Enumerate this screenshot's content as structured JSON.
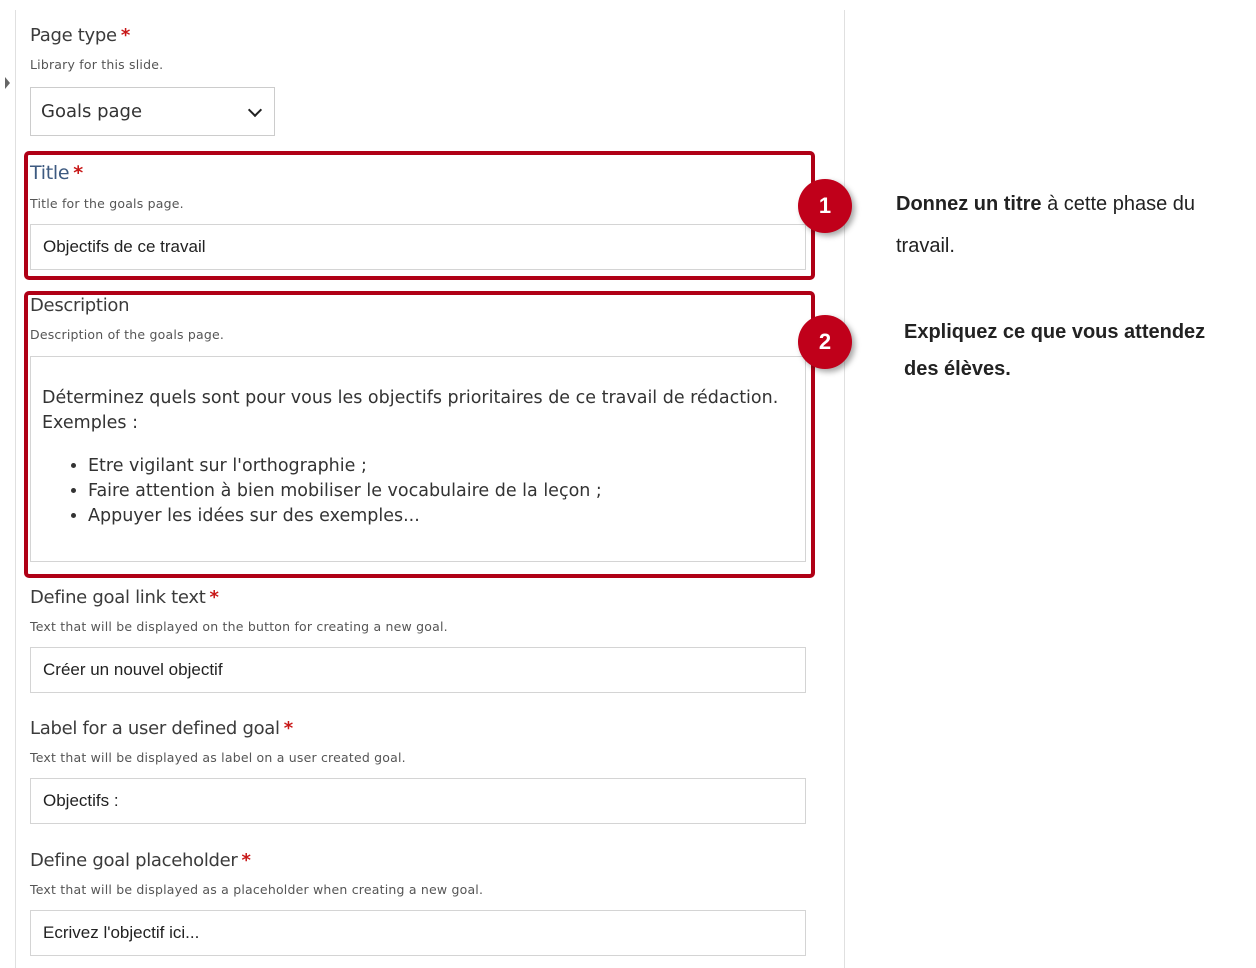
{
  "form": {
    "page_type": {
      "label": "Page type",
      "required": "*",
      "description": "Library for this slide.",
      "selected": "Goals page"
    },
    "title": {
      "label": "Title",
      "required": "*",
      "description": "Title for the goals page.",
      "value": "Objectifs de ce travail"
    },
    "description": {
      "label": "Description",
      "description": "Description of the goals page.",
      "paragraph": "Déterminez quels sont pour vous les objectifs prioritaires de ce travail de rédaction.",
      "paragraph2": "Exemples :",
      "bullets": [
        "Etre vigilant sur l'orthographie ;",
        "Faire attention à bien mobiliser le vocabulaire de la leçon ;",
        "Appuyer les idées sur des exemples..."
      ]
    },
    "goal_link_text": {
      "label": "Define goal link text",
      "required": "*",
      "description": "Text that will be displayed on the button for creating a new goal.",
      "value": "Créer un nouvel objectif"
    },
    "user_goal_label": {
      "label": "Label for a user defined goal",
      "required": "*",
      "description": "Text that will be displayed as label on a user created goal.",
      "value": "Objectifs :"
    },
    "goal_placeholder": {
      "label": "Define goal placeholder",
      "required": "*",
      "description": "Text that will be displayed as a placeholder when creating a new goal.",
      "value": "Ecrivez l'objectif ici..."
    }
  },
  "annotations": {
    "step1": {
      "number": "1",
      "bold": "Donnez un titre",
      "rest": " à cette phase du",
      "line2": "travail."
    },
    "step2": {
      "number": "2",
      "line1": "Expliquez ce que vous attendez",
      "line2": "des élèves."
    }
  },
  "colors": {
    "highlight": "#b00016",
    "badge": "#c0001a",
    "required": "#c81818",
    "title_label": "#3d5a80"
  },
  "icons": {
    "select_chevron": "chevron-down-icon",
    "panel_toggle": "caret-right-icon"
  }
}
